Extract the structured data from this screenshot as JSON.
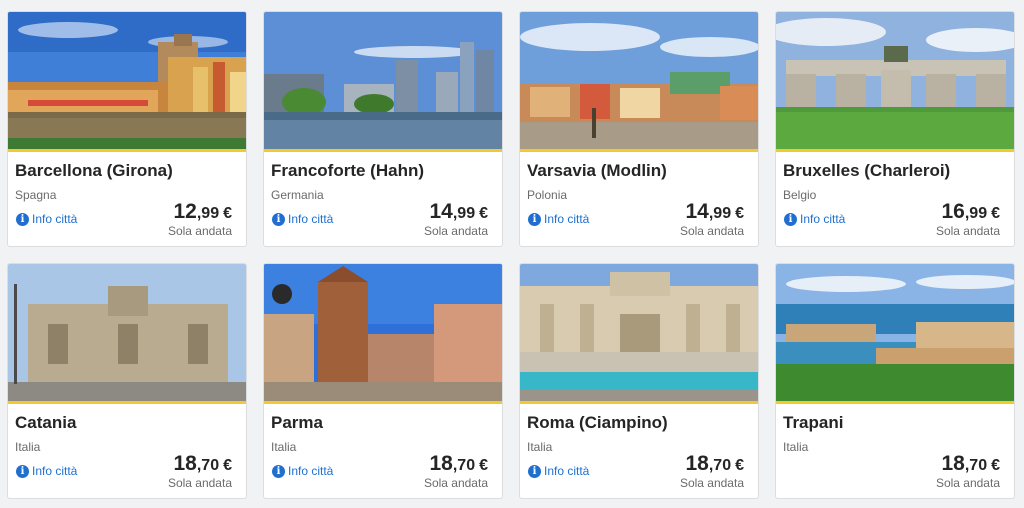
{
  "labels": {
    "info": "Info città",
    "one_way": "Sola andata",
    "currency": "€"
  },
  "cards": [
    {
      "city": "Barcellona (Girona)",
      "country": "Spagna",
      "price_int": "12",
      "price_dec": ",99",
      "has_info": true
    },
    {
      "city": "Francoforte (Hahn)",
      "country": "Germania",
      "price_int": "14",
      "price_dec": ",99",
      "has_info": true
    },
    {
      "city": "Varsavia (Modlin)",
      "country": "Polonia",
      "price_int": "14",
      "price_dec": ",99",
      "has_info": true
    },
    {
      "city": "Bruxelles (Charleroi)",
      "country": "Belgio",
      "price_int": "16",
      "price_dec": ",99",
      "has_info": true
    },
    {
      "city": "Catania",
      "country": "Italia",
      "price_int": "18",
      "price_dec": ",70",
      "has_info": true
    },
    {
      "city": "Parma",
      "country": "Italia",
      "price_int": "18",
      "price_dec": ",70",
      "has_info": true
    },
    {
      "city": "Roma (Ciampino)",
      "country": "Italia",
      "price_int": "18",
      "price_dec": ",70",
      "has_info": true
    },
    {
      "city": "Trapani",
      "country": "Italia",
      "price_int": "18",
      "price_dec": ",70",
      "has_info": false
    }
  ],
  "colors": {
    "accent": "#f1c931",
    "info_link": "#1f6fd1",
    "title": "#252525",
    "muted": "#6b6b6b"
  }
}
